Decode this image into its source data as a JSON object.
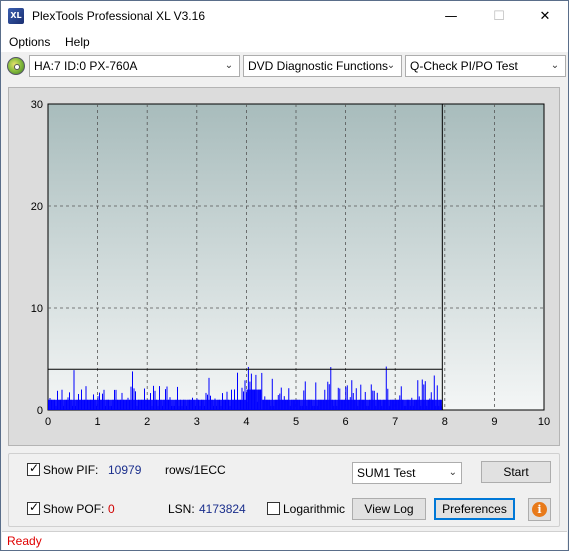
{
  "window": {
    "title": "PlexTools Professional XL V3.16",
    "icon_text": "XL",
    "min_glyph": "—",
    "max_glyph": "☐",
    "close_glyph": "✕"
  },
  "menu": {
    "options": "Options",
    "help": "Help"
  },
  "toolbar": {
    "drive": "HA:7 ID:0  PX-760A",
    "function": "DVD Diagnostic Functions",
    "test": "Q-Check PI/PO Test",
    "dropdown_glyph": "⌄"
  },
  "chart_data": {
    "type": "bar",
    "xlim": [
      0,
      10
    ],
    "ylim": [
      0,
      30
    ],
    "x_ticks": [
      "0",
      "1",
      "2",
      "3",
      "4",
      "5",
      "6",
      "7",
      "8",
      "9",
      "10"
    ],
    "y_ticks": [
      "0",
      "10",
      "20",
      "30"
    ],
    "threshold_line": 4,
    "end_marker_x": 7.95,
    "grid": true,
    "colors": {
      "plot_background_top": "#a8bcbc",
      "plot_background_bottom": "#f4f6f6",
      "bars": "#0000ff",
      "threshold": "#000000"
    },
    "segments": [
      {
        "x_start": 0.0,
        "x_end": 4.0,
        "typical_value": 1,
        "max_value": 4
      },
      {
        "x_start": 4.0,
        "x_end": 4.3,
        "typical_value": 2,
        "max_value": 6
      },
      {
        "x_start": 4.3,
        "x_end": 7.95,
        "typical_value": 1,
        "max_value": 5
      }
    ]
  },
  "controls": {
    "show_pif_label": "Show PIF:",
    "pif_value": "10979",
    "pif_unit": "rows/1ECC",
    "show_pof_label": "Show POF:",
    "pof_value": "0",
    "lsn_label": "LSN:",
    "lsn_value": "4173824",
    "logarithmic_label": "Logarithmic",
    "sum_combo": "SUM1 Test",
    "start_button": "Start",
    "viewlog_button": "View Log",
    "preferences_button": "Preferences",
    "info_glyph": "i"
  },
  "status": {
    "text": "Ready"
  }
}
